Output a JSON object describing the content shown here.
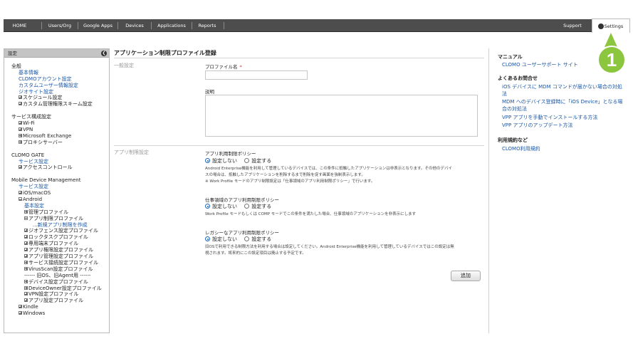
{
  "nav": {
    "items": [
      "HOME",
      "Users/Org",
      "Google Apps",
      "Devices",
      "Applications",
      "Reports"
    ],
    "support": "Support",
    "settings": "Settings"
  },
  "badge": "1",
  "sidebar": {
    "header": "設定",
    "lines": [
      {
        "text": "全般",
        "kind": "section",
        "indent": 0
      },
      {
        "text": "基本情報",
        "kind": "link",
        "indent": 1
      },
      {
        "text": "CLOMOアカウント設定",
        "kind": "link",
        "indent": 1
      },
      {
        "text": "カスタムユーザー情報設定",
        "kind": "link",
        "indent": 1
      },
      {
        "text": "ジオサイト設定",
        "kind": "link",
        "indent": 1
      },
      {
        "text": "スケジュール設定",
        "kind": "plus",
        "indent": 1
      },
      {
        "text": "カスタム管理権限スキーム設定",
        "kind": "plus",
        "indent": 1
      },
      {
        "text": "",
        "kind": "gap"
      },
      {
        "text": "サービス構成設定",
        "kind": "section",
        "indent": 0
      },
      {
        "text": "Wi-Fi",
        "kind": "plus",
        "indent": 1
      },
      {
        "text": "VPN",
        "kind": "plus",
        "indent": 1
      },
      {
        "text": "Microsoft Exchange",
        "kind": "plus",
        "indent": 1
      },
      {
        "text": "プロキシサーバー",
        "kind": "plus",
        "indent": 1
      },
      {
        "text": "",
        "kind": "gap"
      },
      {
        "text": "CLOMO GATE",
        "kind": "section",
        "indent": 0
      },
      {
        "text": "サービス設定",
        "kind": "link",
        "indent": 1
      },
      {
        "text": "アクセスコントロール",
        "kind": "plus",
        "indent": 1
      },
      {
        "text": "",
        "kind": "gap"
      },
      {
        "text": "Mobile Device Management",
        "kind": "section",
        "indent": 0
      },
      {
        "text": "サービス設定",
        "kind": "link",
        "indent": 1
      },
      {
        "text": "iOS/macOS",
        "kind": "plus",
        "indent": 1
      },
      {
        "text": "Android",
        "kind": "minus",
        "indent": 1
      },
      {
        "text": "基本設定",
        "kind": "link",
        "indent": 2
      },
      {
        "text": "管理プロファイル",
        "kind": "plus",
        "indent": 2
      },
      {
        "text": "アプリ制限プロファイル",
        "kind": "minus",
        "indent": 2
      },
      {
        "text": "...新規アプリ制限を作成",
        "kind": "link",
        "indent": 4
      },
      {
        "text": "ジオフェンス設定プロファイル",
        "kind": "plus",
        "indent": 2
      },
      {
        "text": "ロックタスクプロファイル",
        "kind": "plus",
        "indent": 2
      },
      {
        "text": "専用端末プロファイル",
        "kind": "plus",
        "indent": 2
      },
      {
        "text": "アプリ権限設定プロファイル",
        "kind": "plus",
        "indent": 2
      },
      {
        "text": "アプリ管理設定プロファイル",
        "kind": "plus",
        "indent": 2
      },
      {
        "text": "サービス接続設定プロファイル",
        "kind": "plus",
        "indent": 2
      },
      {
        "text": "VirusScan設定プロファイル",
        "kind": "plus",
        "indent": 2
      },
      {
        "text": "------ 旧OS、旧Agent用 ------",
        "kind": "text",
        "indent": 2
      },
      {
        "text": "デバイス設定プロファイル",
        "kind": "plus",
        "indent": 2
      },
      {
        "text": "DeviceOwner設定プロファイル",
        "kind": "plus",
        "indent": 2
      },
      {
        "text": "VPN設定プロファイル",
        "kind": "plus",
        "indent": 2
      },
      {
        "text": "アプリ設定プロファイル",
        "kind": "plus",
        "indent": 2
      },
      {
        "text": "Kindle",
        "kind": "plus",
        "indent": 1
      },
      {
        "text": "Windows",
        "kind": "plus",
        "indent": 1
      }
    ]
  },
  "main": {
    "title": "アプリケーション制限プロファイル登録",
    "general_label": "一般設定",
    "profile_name_label": "プロファイル名",
    "required_mark": "*",
    "profile_name_value": "",
    "description_label": "説明",
    "description_value": "",
    "app_restrict_label": "アプリ制限設定",
    "policies": [
      {
        "label": "アプリ利用制限ポリシー",
        "options": [
          "設定しない",
          "設定する"
        ],
        "selected": "設定しない",
        "desc": [
          "Android Enterprise機能を利用して管理しているデバイスでは、この条件に抵触したアプリケーションは非表示となります。その他のデバイ",
          "スの場合は、抵触したアプリケーションを削除するまで削除を促す画面を強制表示します。",
          "※ Work Profile モードのアプリ制限設定は「仕事領域のアプリ利用制限ポリシー」で行います。"
        ]
      },
      {
        "label": "仕事領域のアプリ利用制限ポリシー",
        "options": [
          "設定しない",
          "設定する"
        ],
        "selected": "設定しない",
        "desc": [
          "Work Profile モードもしくは COMP モードでこの条件を満たした場合、仕事領域のアプリケーションを非表示にします"
        ]
      },
      {
        "label": "レガシーなアプリ利用制限ポリシー",
        "options": [
          "設定しない",
          "設定する"
        ],
        "selected": "設定しない",
        "desc": [
          "旧OSで利用できる制限方法を利用する場合は設定してください。Android Enterprise機能を利用して管理しているデバイスではこの設定は無",
          "視されます。将来的にこの設定項目は廃止する予定です。"
        ]
      }
    ],
    "add_button": "追加"
  },
  "right": {
    "sections": [
      {
        "title": "マニュアル",
        "links": [
          "CLOMO ユーザーサポート サイト"
        ]
      },
      {
        "title": "よくあるお問合せ",
        "links": [
          "iOS デバイスに MDM コマンドが届かない場合の対処法",
          "MDM へのデバイス登録時に「iOS Device」となる場合の対処法",
          "VPP アプリを手動でインストールする方法",
          "VPP アプリのアップデート方法"
        ]
      },
      {
        "title": "利用規約など",
        "links": [
          "CLOMO利用規約"
        ]
      }
    ]
  }
}
